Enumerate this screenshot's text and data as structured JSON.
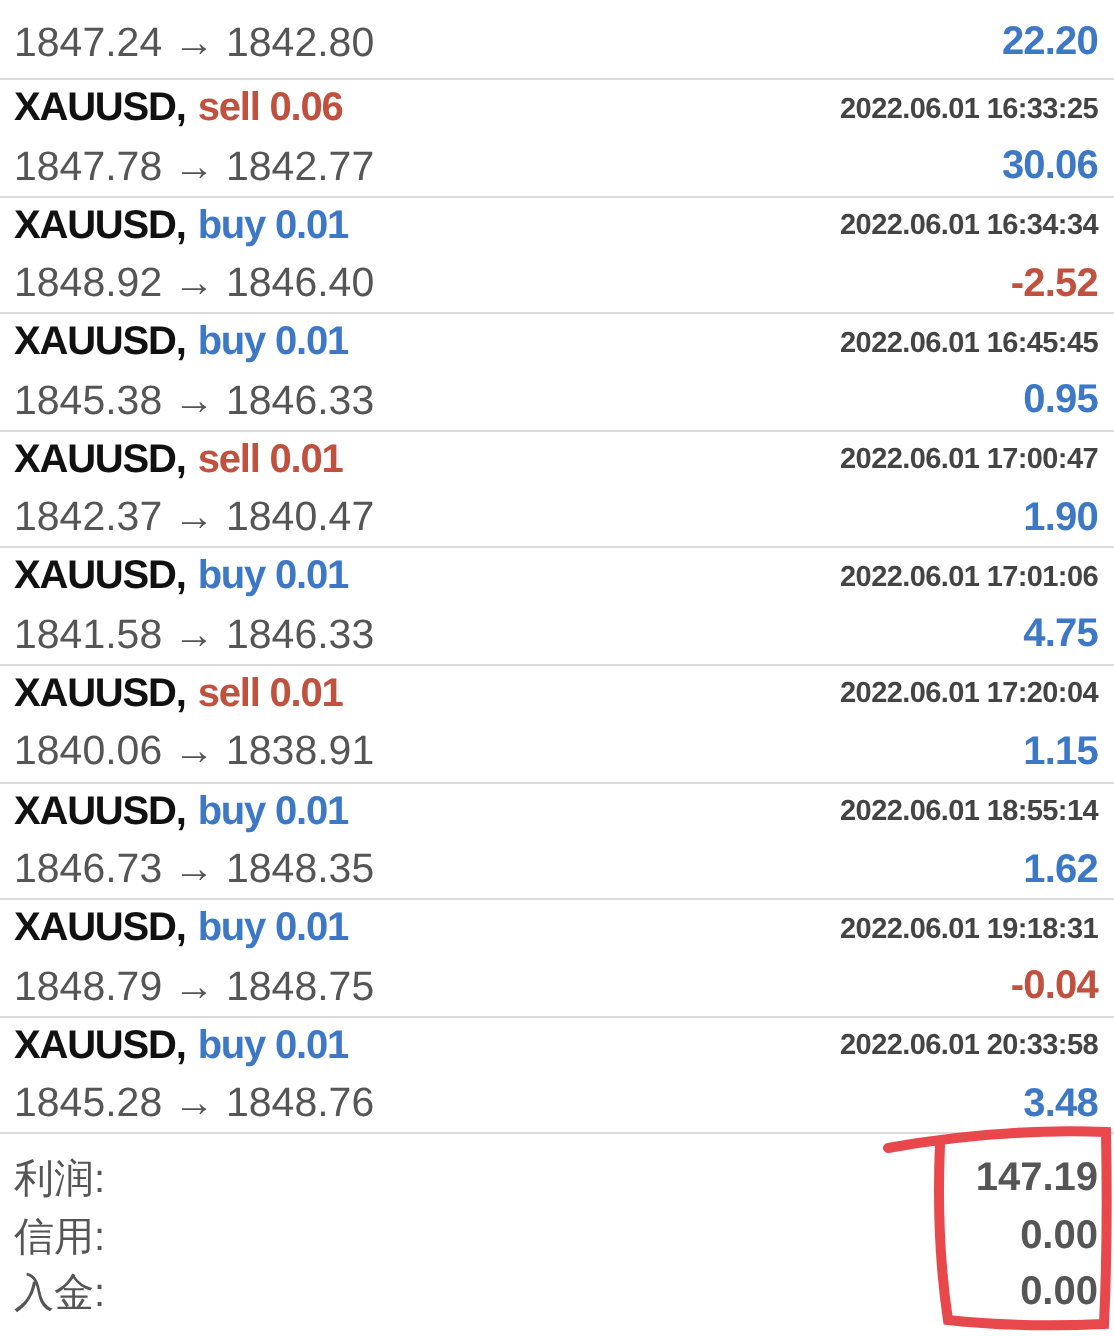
{
  "trades": [
    {
      "prices": "1847.24 → 1842.80",
      "profit": {
        "text": "22.20",
        "color": "#3d78c6"
      }
    },
    {
      "symbol": "XAUUSD,",
      "order": {
        "text": "sell 0.06",
        "color": "#c0513f"
      },
      "time": "2022.06.01 16:33:25",
      "prices": "1847.78 → 1842.77",
      "profit": {
        "text": "30.06",
        "color": "#3d78c6"
      }
    },
    {
      "symbol": "XAUUSD,",
      "order": {
        "text": "buy 0.01",
        "color": "#3d78c6"
      },
      "time": "2022.06.01 16:34:34",
      "prices": "1848.92 → 1846.40",
      "profit": {
        "text": "-2.52",
        "color": "#c0513f"
      }
    },
    {
      "symbol": "XAUUSD,",
      "order": {
        "text": "buy 0.01",
        "color": "#3d78c6"
      },
      "time": "2022.06.01 16:45:45",
      "prices": "1845.38 → 1846.33",
      "profit": {
        "text": "0.95",
        "color": "#3d78c6"
      }
    },
    {
      "symbol": "XAUUSD,",
      "order": {
        "text": "sell 0.01",
        "color": "#c0513f"
      },
      "time": "2022.06.01 17:00:47",
      "prices": "1842.37 → 1840.47",
      "profit": {
        "text": "1.90",
        "color": "#3d78c6"
      }
    },
    {
      "symbol": "XAUUSD,",
      "order": {
        "text": "buy 0.01",
        "color": "#3d78c6"
      },
      "time": "2022.06.01 17:01:06",
      "prices": "1841.58 → 1846.33",
      "profit": {
        "text": "4.75",
        "color": "#3d78c6"
      }
    },
    {
      "symbol": "XAUUSD,",
      "order": {
        "text": "sell 0.01",
        "color": "#c0513f"
      },
      "time": "2022.06.01 17:20:04",
      "prices": "1840.06 → 1838.91",
      "profit": {
        "text": "1.15",
        "color": "#3d78c6"
      }
    },
    {
      "symbol": "XAUUSD,",
      "order": {
        "text": "buy 0.01",
        "color": "#3d78c6"
      },
      "time": "2022.06.01 18:55:14",
      "prices": "1846.73 → 1848.35",
      "profit": {
        "text": "1.62",
        "color": "#3d78c6"
      }
    },
    {
      "symbol": "XAUUSD,",
      "order": {
        "text": "buy 0.01",
        "color": "#3d78c6"
      },
      "time": "2022.06.01 19:18:31",
      "prices": "1848.79 → 1848.75",
      "profit": {
        "text": "-0.04",
        "color": "#c0513f"
      }
    },
    {
      "symbol": "XAUUSD,",
      "order": {
        "text": "buy 0.01",
        "color": "#3d78c6"
      },
      "time": "2022.06.01 20:33:58",
      "prices": "1845.28 → 1848.76",
      "profit": {
        "text": "3.48",
        "color": "#3d78c6"
      }
    }
  ],
  "summary": [
    {
      "label": "利润:",
      "value": "147.19"
    },
    {
      "label": "信用:",
      "value": "0.00"
    },
    {
      "label": "入金:",
      "value": "0.00"
    }
  ],
  "annotation": {
    "kind": "loop"
  }
}
